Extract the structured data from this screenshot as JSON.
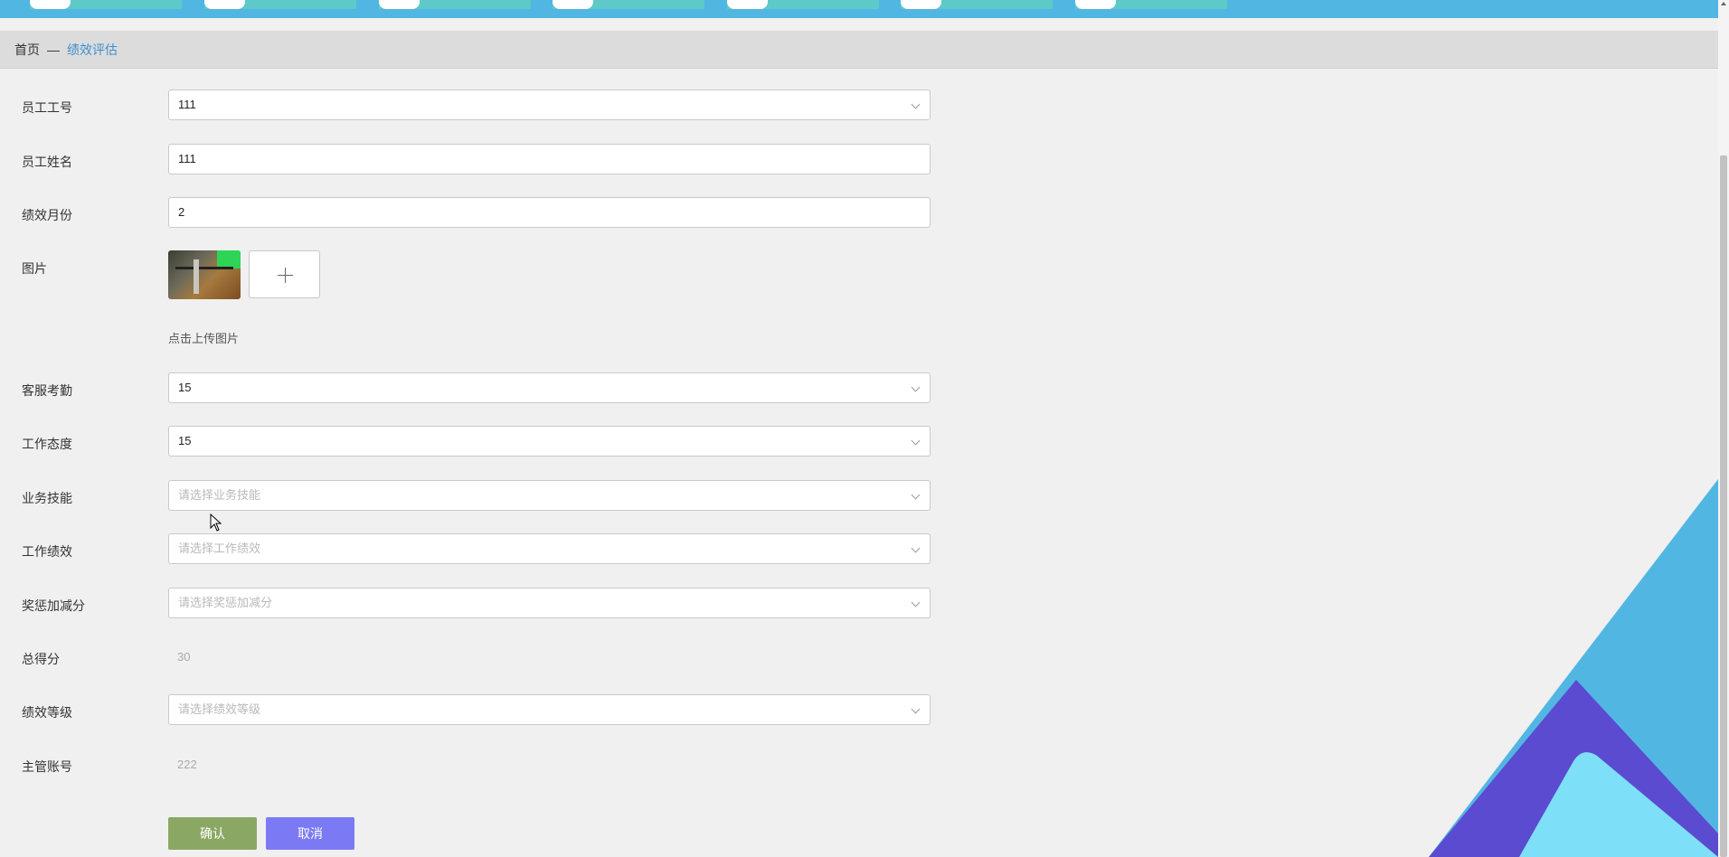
{
  "breadcrumb": {
    "home": "首页",
    "separator": "—",
    "current": "绩效评估"
  },
  "form": {
    "employee_no": {
      "label": "员工工号",
      "value": "111"
    },
    "employee_name": {
      "label": "员工姓名",
      "value": "111"
    },
    "perf_month": {
      "label": "绩效月份",
      "value": "2"
    },
    "image": {
      "label": "图片",
      "hint": "点击上传图片"
    },
    "attendance": {
      "label": "客服考勤",
      "value": "15"
    },
    "attitude": {
      "label": "工作态度",
      "value": "15"
    },
    "skill": {
      "label": "业务技能",
      "placeholder": "请选择业务技能"
    },
    "performance": {
      "label": "工作绩效",
      "placeholder": "请选择工作绩效"
    },
    "bonus": {
      "label": "奖惩加减分",
      "placeholder": "请选择奖惩加减分"
    },
    "total": {
      "label": "总得分",
      "value": "30"
    },
    "grade": {
      "label": "绩效等级",
      "placeholder": "请选择绩效等级"
    },
    "manager": {
      "label": "主管账号",
      "value": "222"
    }
  },
  "buttons": {
    "confirm": "确认",
    "cancel": "取消"
  },
  "colors": {
    "nav": "#52b6e3",
    "link": "#3d8fd1",
    "confirm": "#8aa864",
    "cancel": "#7b7af4"
  }
}
